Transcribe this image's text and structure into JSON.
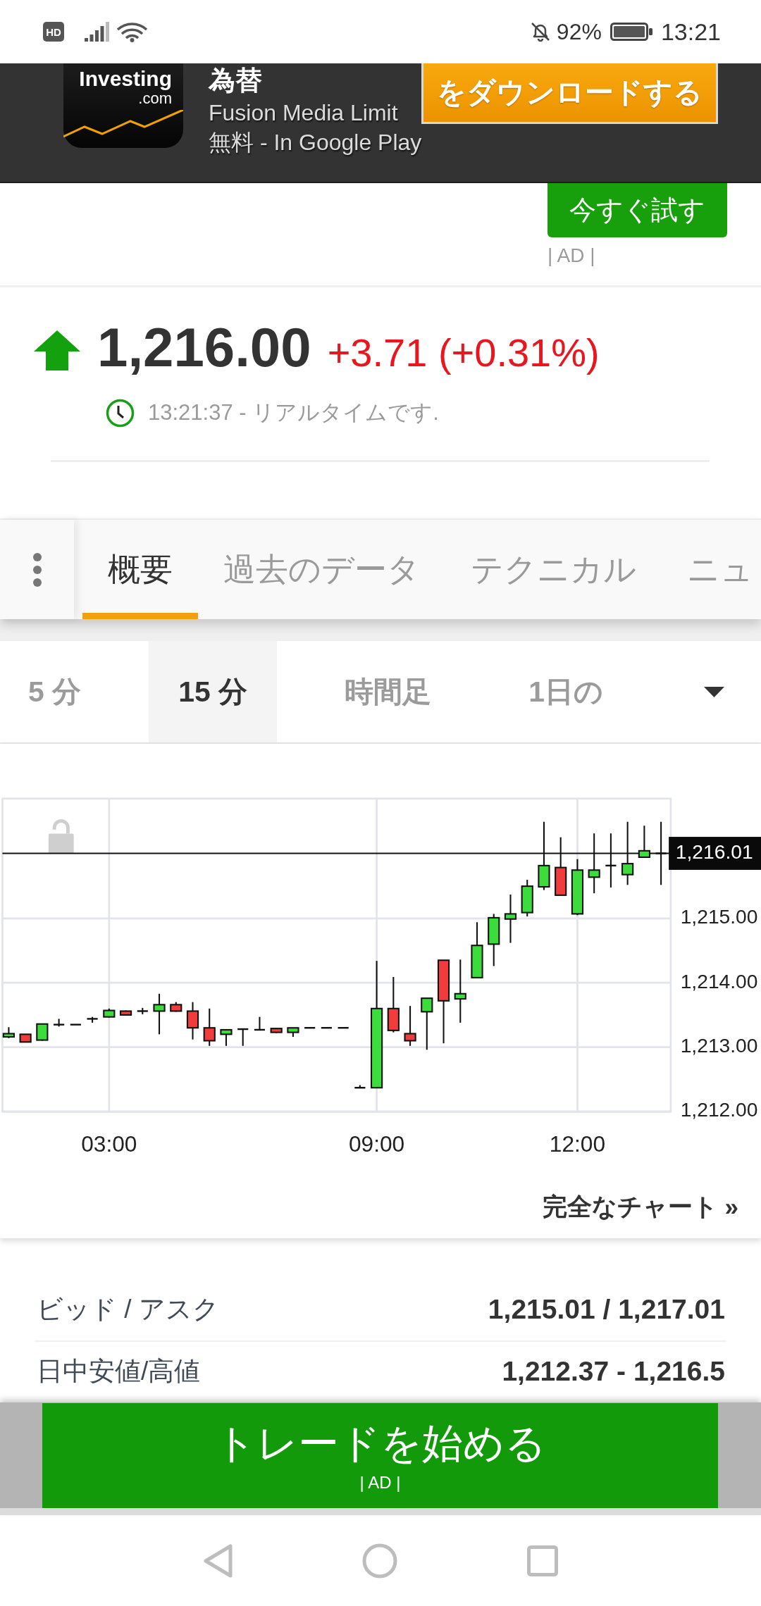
{
  "status_bar": {
    "badge": "HD",
    "battery": "92%",
    "time": "13:21"
  },
  "ad_banner": {
    "logo_word": "Investing",
    "logo_domain": ".com",
    "title": "為替",
    "publisher": "Fusion Media Limit",
    "store_line": "無料 - In Google Play",
    "download_button": "をダウンロードする",
    "try_button": "今すぐ試す",
    "ad_label": "| AD |"
  },
  "quote": {
    "price_up": true,
    "price": "1,216.00",
    "change": "+3.71 (+0.31%)",
    "timestamp": "13:21:37 - リアルタイムです."
  },
  "tabs": [
    {
      "label": "概要",
      "selected": true
    },
    {
      "label": "過去のデータ",
      "selected": false
    },
    {
      "label": "テクニカル",
      "selected": false
    },
    {
      "label": "ニュ",
      "selected": false
    }
  ],
  "timeframes": [
    {
      "label": "5 分",
      "selected": false
    },
    {
      "label": "15 分",
      "selected": true
    },
    {
      "label": "時間足",
      "selected": false
    },
    {
      "label": "1日の",
      "selected": false
    }
  ],
  "chart": {
    "chart_data": {
      "type": "candlestick",
      "categories": [
        null,
        null,
        null,
        null,
        null,
        null,
        "03:00",
        null,
        null,
        null,
        null,
        null,
        null,
        null,
        null,
        null,
        null,
        null,
        null,
        null,
        null,
        null,
        "09:00",
        null,
        null,
        null,
        null,
        null,
        null,
        null,
        null,
        null,
        null,
        null,
        "12:00",
        null,
        null,
        null,
        null,
        null
      ],
      "ohlc": [
        [
          1213.16,
          1213.31,
          1213.14,
          1213.21
        ],
        [
          1213.2,
          1213.2,
          1213.08,
          1213.08
        ],
        [
          1213.11,
          1213.36,
          1213.1,
          1213.36
        ],
        [
          1213.35,
          1213.44,
          1213.32,
          1213.35
        ],
        [
          1213.35,
          1213.35,
          1213.35,
          1213.35
        ],
        [
          1213.44,
          1213.47,
          1213.38,
          1213.44
        ],
        [
          1213.47,
          1213.6,
          1213.46,
          1213.57
        ],
        [
          1213.56,
          1213.57,
          1213.49,
          1213.5
        ],
        [
          1213.56,
          1213.61,
          1213.51,
          1213.56
        ],
        [
          1213.56,
          1213.83,
          1213.2,
          1213.66
        ],
        [
          1213.66,
          1213.7,
          1213.55,
          1213.56
        ],
        [
          1213.56,
          1213.7,
          1213.12,
          1213.3
        ],
        [
          1213.3,
          1213.6,
          1213.02,
          1213.1
        ],
        [
          1213.2,
          1213.27,
          1213.02,
          1213.27
        ],
        [
          1213.28,
          1213.29,
          1213.02,
          1213.28
        ],
        [
          1213.27,
          1213.47,
          1213.26,
          1213.27
        ],
        [
          1213.29,
          1213.29,
          1213.22,
          1213.23
        ],
        [
          1213.23,
          1213.3,
          1213.16,
          1213.3
        ],
        [
          1213.3,
          1213.3,
          1213.3,
          1213.3
        ],
        [
          1213.3,
          1213.3,
          1213.3,
          1213.3
        ],
        [
          1213.3,
          1213.3,
          1213.3,
          1213.3
        ],
        [
          1212.37,
          1212.41,
          1212.37,
          1212.37
        ],
        [
          1212.37,
          1214.34,
          1212.37,
          1213.6
        ],
        [
          1213.6,
          1214.09,
          1213.23,
          1213.26
        ],
        [
          1213.21,
          1213.64,
          1213.02,
          1213.1
        ],
        [
          1213.55,
          1213.76,
          1212.96,
          1213.76
        ],
        [
          1214.35,
          1214.35,
          1213.06,
          1213.72
        ],
        [
          1213.75,
          1214.36,
          1213.38,
          1213.83
        ],
        [
          1214.08,
          1214.94,
          1214.08,
          1214.58
        ],
        [
          1214.6,
          1215.07,
          1214.26,
          1215.01
        ],
        [
          1214.99,
          1215.37,
          1214.62,
          1215.07
        ],
        [
          1215.09,
          1215.6,
          1215.03,
          1215.5
        ],
        [
          1215.49,
          1216.5,
          1215.44,
          1215.82
        ],
        [
          1215.79,
          1216.26,
          1215.36,
          1215.36
        ],
        [
          1215.07,
          1215.92,
          1215.05,
          1215.75
        ],
        [
          1215.64,
          1216.32,
          1215.39,
          1215.75
        ],
        [
          1215.82,
          1216.32,
          1215.48,
          1215.82
        ],
        [
          1215.68,
          1216.5,
          1215.52,
          1215.85
        ],
        [
          1215.95,
          1216.44,
          1215.95,
          1216.05
        ],
        [
          1216.01,
          1216.5,
          1215.52,
          1216.01
        ]
      ],
      "ylim": [
        1212,
        1216.86
      ],
      "yticks": [
        {
          "value": 1215,
          "label": "1,215.00"
        },
        {
          "value": 1214,
          "label": "1,214.00"
        },
        {
          "value": 1213,
          "label": "1,213.00"
        },
        {
          "value": 1212,
          "label": "1,212.00"
        }
      ],
      "grid": true,
      "ref_lines": [
        {
          "axis": "y",
          "value": 1216.01,
          "label": "1,216.01"
        }
      ]
    },
    "full_chart_link": "完全なチャート »"
  },
  "stats": [
    {
      "label": "ビッド / アスク",
      "value": "1,215.01 / 1,217.01"
    },
    {
      "label": "日中安値/高値",
      "value": "1,212.37 - 1,216.5"
    }
  ],
  "trade_ad": {
    "button": "トレードを始める",
    "ad_label": "| AD |"
  }
}
